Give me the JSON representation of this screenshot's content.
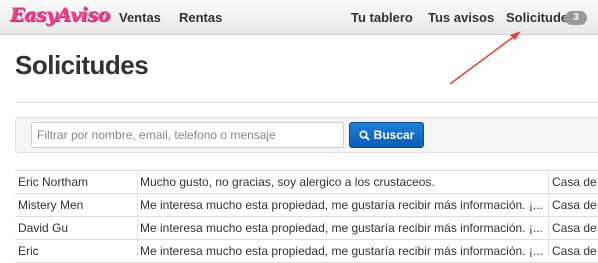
{
  "navbar": {
    "logo": "EasyAviso",
    "left_links": [
      {
        "label": "Ventas"
      },
      {
        "label": "Rentas"
      }
    ],
    "right_links": [
      {
        "label": "Tu tablero"
      },
      {
        "label": "Tus avisos"
      },
      {
        "label": "Solicitudes"
      }
    ],
    "solicitudes_badge": "3"
  },
  "page": {
    "title": "Solicitudes"
  },
  "search": {
    "placeholder": "Filtrar por nombre, email, telefono o mensaje",
    "value": "",
    "button_label": "Buscar"
  },
  "table": {
    "rows": [
      {
        "name": "Eric Northam",
        "message": "Mucho gusto, no gracias, soy alergico a los crustaceos.",
        "property": "Casa de"
      },
      {
        "name": "Mistery Men",
        "message": "Me interesa mucho esta propiedad, me gustaría recibir más información. ¡...",
        "property": "Casa de"
      },
      {
        "name": "David Gu",
        "message": "Me interesa mucho esta propiedad, me gustaría recibir más información. ¡...",
        "property": "Casa de"
      },
      {
        "name": "Eric",
        "message": "Me interesa mucho esta propiedad, me gustaría recibir más información. ¡...",
        "property": "Casa de"
      }
    ]
  },
  "colors": {
    "logo": "#ec3f8c",
    "button": "#0a5db8",
    "annotation_arrow": "#e8413c"
  }
}
